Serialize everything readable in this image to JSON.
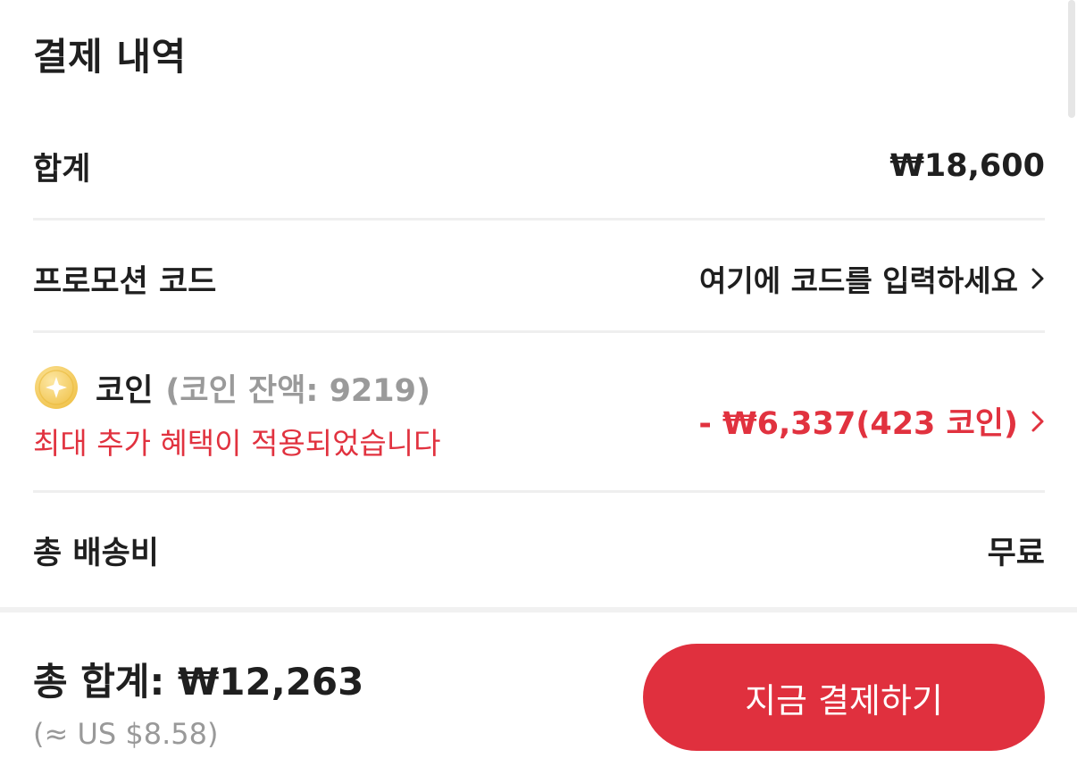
{
  "header": {
    "title": "결제 내역"
  },
  "summary": {
    "subtotal_label": "합계",
    "subtotal_value": "₩18,600",
    "promo_label": "프로모션 코드",
    "promo_placeholder": "여기에 코드를 입력하세요",
    "coin_label": "코인",
    "coin_balance": "(코인 잔액: 9219)",
    "coin_benefit": "최대 추가 혜택이 적용되었습니다",
    "coin_discount": "- ₩6,337(423 코인)",
    "shipping_label": "총 배송비",
    "shipping_value": "무료"
  },
  "footer": {
    "total_line": "총 합계: ₩12,263",
    "usd_line": "(≈ US $8.58)",
    "pay_button_label": "지금 결제하기"
  },
  "icons": {
    "coin": "coin-icon",
    "chevron": "chevron-right-icon"
  },
  "colors": {
    "accent": "#e0303e",
    "muted": "#999999",
    "coin_gold": "#f3c84a"
  }
}
